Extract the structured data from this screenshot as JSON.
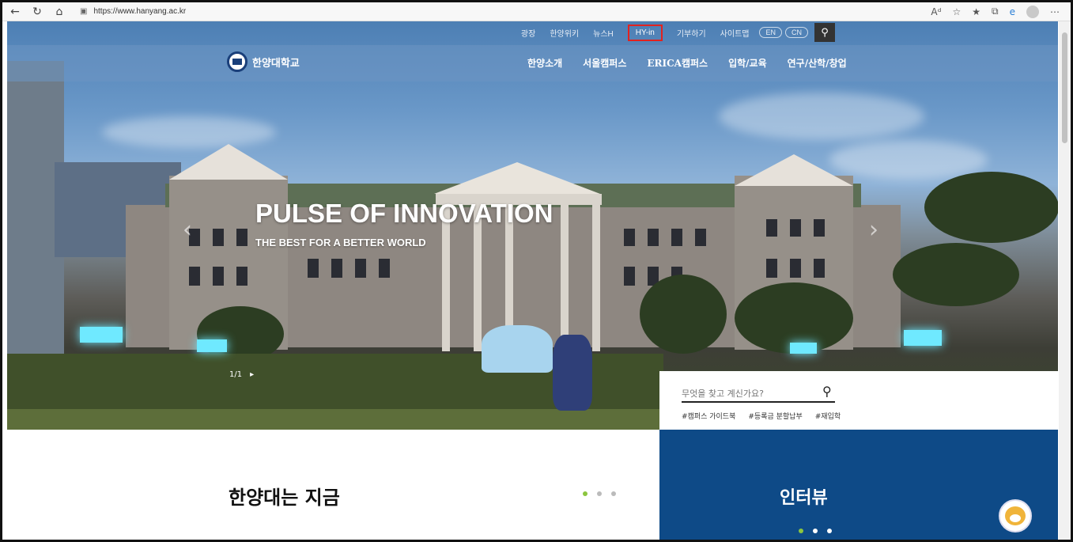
{
  "browser": {
    "url": "https://www.hanyang.ac.kr",
    "icons": [
      "back-arrow-icon",
      "refresh-icon",
      "home-icon",
      "lock-icon",
      "read-aloud-icon",
      "add-favorite-icon",
      "favorites-icon",
      "collections-icon",
      "edge-icon",
      "profile-icon",
      "more-icon"
    ]
  },
  "utility_nav": {
    "links": [
      "광장",
      "한양위키",
      "뉴스H",
      "HY-in",
      "기부하기",
      "사이트맵"
    ],
    "highlighted": "HY-in",
    "lang_en": "EN",
    "lang_cn": "CN"
  },
  "logo_text": "한양대학교",
  "main_menu": [
    "한양소개",
    "서울캠퍼스",
    "ERICA캠퍼스",
    "입학/교육",
    "연구/산학/창업"
  ],
  "hero": {
    "title": "PULSE OF INNOVATION",
    "subtitle": "THE BEST FOR A BETTER WORLD",
    "pager": "1/1"
  },
  "search": {
    "placeholder": "무엇을 찾고 계신가요?",
    "tags": [
      "#캠퍼스 가이드북",
      "#등록금 분할납부",
      "#재입학"
    ]
  },
  "sections": {
    "now_title": "한양대는 지금",
    "interview_title": "인터뷰"
  },
  "colors": {
    "interview_bg": "#0e4a87",
    "highlight_border": "#e2221f",
    "dot_active": "#8cc63f"
  }
}
